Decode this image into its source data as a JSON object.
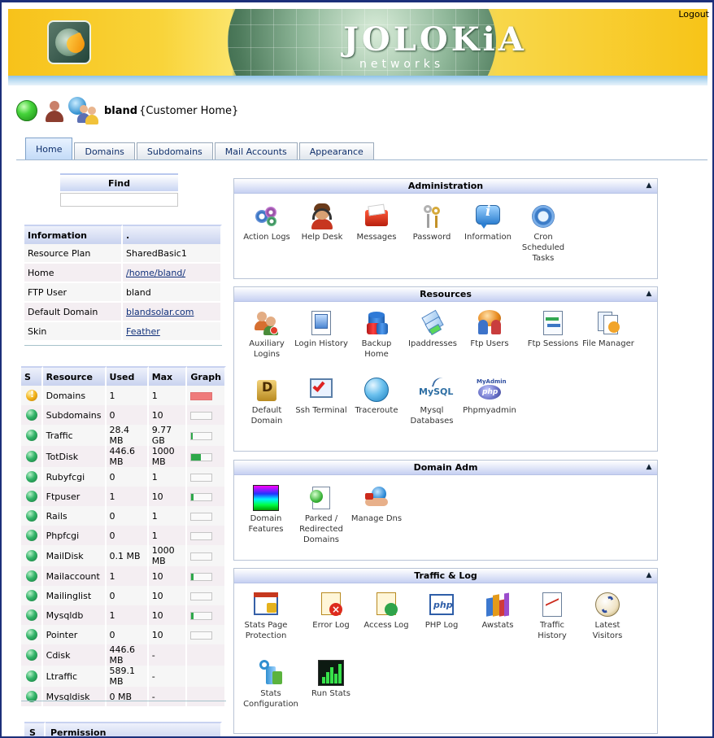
{
  "header": {
    "brand_name": "JOLOKiA",
    "brand_sub": "networks",
    "logout_label": "Logout"
  },
  "user": {
    "name": "bland",
    "context": "{Customer Home}"
  },
  "tabs": [
    {
      "label": "Home",
      "active": true
    },
    {
      "label": "Domains",
      "active": false
    },
    {
      "label": "Subdomains",
      "active": false
    },
    {
      "label": "Mail Accounts",
      "active": false
    },
    {
      "label": "Appearance",
      "active": false
    }
  ],
  "find": {
    "title": "Find",
    "value": ""
  },
  "information": {
    "header": [
      "Information",
      "."
    ],
    "rows": [
      {
        "label": "Resource Plan",
        "value": "SharedBasic1",
        "link": false
      },
      {
        "label": "Home",
        "value": "/home/bland/",
        "link": true
      },
      {
        "label": "FTP User",
        "value": "bland",
        "link": false
      },
      {
        "label": "Default Domain",
        "value": "blandsolar.com",
        "link": true
      },
      {
        "label": "Skin",
        "value": "Feather",
        "link": true
      }
    ]
  },
  "resources_table": {
    "columns": [
      "S",
      "Resource",
      "Used",
      "Max",
      "Graph"
    ],
    "rows": [
      {
        "status": "warning",
        "resource": "Domains",
        "used": "1",
        "max": "1",
        "fill": 1.0
      },
      {
        "status": "ok",
        "resource": "Subdomains",
        "used": "0",
        "max": "10",
        "fill": 0.0
      },
      {
        "status": "ok",
        "resource": "Traffic",
        "used": "28.4 MB",
        "max": "9.77 GB",
        "fill": 0.003
      },
      {
        "status": "ok",
        "resource": "TotDisk",
        "used": "446.6 MB",
        "max": "1000 MB",
        "fill": 0.45
      },
      {
        "status": "ok",
        "resource": "Rubyfcgi",
        "used": "0",
        "max": "1",
        "fill": 0.0
      },
      {
        "status": "ok",
        "resource": "Ftpuser",
        "used": "1",
        "max": "10",
        "fill": 0.1
      },
      {
        "status": "ok",
        "resource": "Rails",
        "used": "0",
        "max": "1",
        "fill": 0.0
      },
      {
        "status": "ok",
        "resource": "Phpfcgi",
        "used": "0",
        "max": "1",
        "fill": 0.0
      },
      {
        "status": "ok",
        "resource": "MailDisk",
        "used": "0.1 MB",
        "max": "1000 MB",
        "fill": 0.0
      },
      {
        "status": "ok",
        "resource": "Mailaccount",
        "used": "1",
        "max": "10",
        "fill": 0.1
      },
      {
        "status": "ok",
        "resource": "Mailinglist",
        "used": "0",
        "max": "10",
        "fill": 0.0
      },
      {
        "status": "ok",
        "resource": "Mysqldb",
        "used": "1",
        "max": "10",
        "fill": 0.1
      },
      {
        "status": "ok",
        "resource": "Pointer",
        "used": "0",
        "max": "10",
        "fill": 0.0
      },
      {
        "status": "ok",
        "resource": "Cdisk",
        "used": "446.6 MB",
        "max": "-",
        "fill": null
      },
      {
        "status": "ok",
        "resource": "Ltraffic",
        "used": "589.1 MB",
        "max": "-",
        "fill": null
      },
      {
        "status": "ok",
        "resource": "Mysqldisk",
        "used": "0 MB",
        "max": "-",
        "fill": null
      }
    ]
  },
  "permission_table": {
    "columns": [
      "S",
      "Permission"
    ]
  },
  "panels": {
    "administration": {
      "title": "Administration",
      "items": [
        "Action Logs",
        "Help Desk",
        "Messages",
        "Password",
        "Information",
        "Cron Scheduled Tasks"
      ]
    },
    "resources": {
      "title": "Resources",
      "items": [
        "Auxiliary Logins",
        "Login History",
        "Backup Home",
        "Ipaddresses",
        "Ftp Users",
        "Ftp Sessions",
        "File Manager",
        "Default Domain",
        "Ssh Terminal",
        "Traceroute",
        "Mysql Databases",
        "Phpmyadmin"
      ]
    },
    "domain_adm": {
      "title": "Domain Adm",
      "items": [
        "Domain Features",
        "Parked / Redirected Domains",
        "Manage Dns"
      ]
    },
    "traffic_log": {
      "title": "Traffic & Log",
      "items": [
        "Stats Page Protection",
        "Error Log",
        "Access Log",
        "PHP Log",
        "Awstats",
        "Traffic History",
        "Latest Visitors",
        "Stats Configuration",
        "Run Stats"
      ]
    }
  },
  "icon_text": {
    "mysql": "MySQL",
    "phpmyadmin": "MyAdmin",
    "php": "php"
  },
  "colors": {
    "status_ok": "#32b368",
    "status_warning": "#f3b21a",
    "bar_fill": "#2ea84a",
    "bar_full": "#ef7b7b",
    "link": "#10307a",
    "panel_header": "#c6d0f2"
  }
}
